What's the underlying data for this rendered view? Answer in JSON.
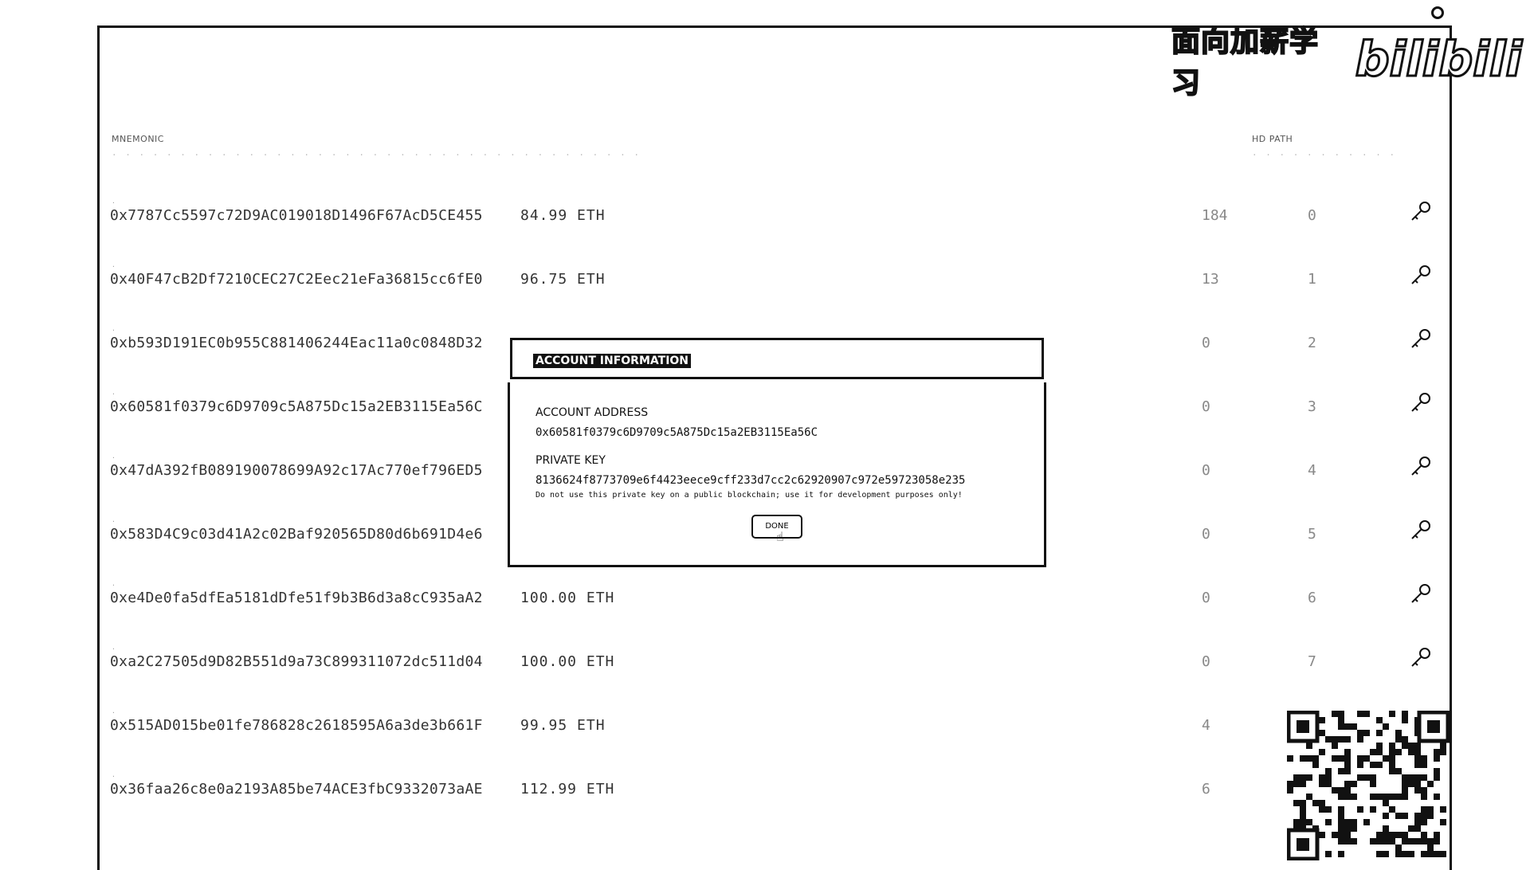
{
  "watermark": {
    "text": "面向加薪学习",
    "logo": "bilibili"
  },
  "headers": {
    "mnemonic_label": "MNEMONIC",
    "hd_path_label": "HD PATH"
  },
  "accounts": [
    {
      "address": "0x7787Cc5597c72D9AC019018D1496F67AcD5CE455",
      "balance": "84.99 ETH",
      "tx_count": "184",
      "index": "0"
    },
    {
      "address": "0x40F47cB2Df7210CEC27C2Eec21eFa36815cc6fE0",
      "balance": "96.75 ETH",
      "tx_count": "13",
      "index": "1"
    },
    {
      "address": "0xb593D191EC0b955C881406244Eac11a0c0848D32",
      "balance": "",
      "tx_count": "0",
      "index": "2"
    },
    {
      "address": "0x60581f0379c6D9709c5A875Dc15a2EB3115Ea56C",
      "balance": "",
      "tx_count": "0",
      "index": "3"
    },
    {
      "address": "0x47dA392fB089190078699A92c17Ac770ef796ED5",
      "balance": "",
      "tx_count": "0",
      "index": "4"
    },
    {
      "address": "0x583D4C9c03d41A2c02Baf920565D80d6b691D4e6",
      "balance": "",
      "tx_count": "0",
      "index": "5"
    },
    {
      "address": "0xe4De0fa5dfEa5181dDfe51f9b3B6d3a8cC935aA2",
      "balance": "100.00 ETH",
      "tx_count": "0",
      "index": "6"
    },
    {
      "address": "0xa2C27505d9D82B551d9a73C899311072dc511d04",
      "balance": "100.00 ETH",
      "tx_count": "0",
      "index": "7"
    },
    {
      "address": "0x515AD015be01fe786828c2618595A6a3de3b661F",
      "balance": "99.95 ETH",
      "tx_count": "4",
      "index": ""
    },
    {
      "address": "0x36faa26c8e0a2193A85be74ACE3fbC9332073aAE",
      "balance": "112.99 ETH",
      "tx_count": "6",
      "index": ""
    }
  ],
  "modal": {
    "title": "ACCOUNT INFORMATION",
    "address_label": "ACCOUNT ADDRESS",
    "address_value": "0x60581f0379c6D9709c5A875Dc15a2EB3115Ea56C",
    "key_label": "PRIVATE KEY",
    "key_value": "8136624f8773709e6f4423eece9cff233d7cc2c62920907c972e59723058e235",
    "warning": "Do not use this private key on a public blockchain; use it for development purposes only!",
    "done_label": "DONE"
  },
  "icons": {
    "row_action": "key-icon",
    "cursor": "pointer-hand-icon"
  }
}
